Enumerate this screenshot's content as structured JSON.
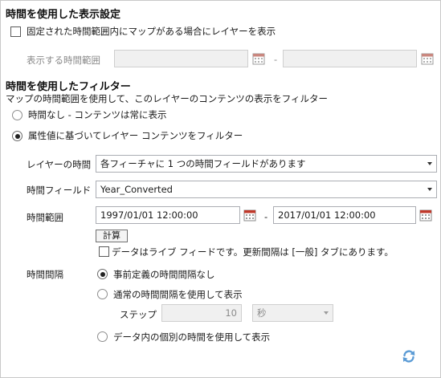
{
  "display_settings": {
    "title": "時間を使用した表示設定",
    "checkbox_label": "固定された時間範囲内にマップがある場合にレイヤーを表示",
    "range_label": "表示する時間範囲",
    "separator": "-",
    "start_value": "",
    "end_value": ""
  },
  "filter": {
    "title": "時間を使用したフィルター",
    "subtitle": "マップの時間範囲を使用して、このレイヤーのコンテンツの表示をフィルター",
    "radio_no_time": "時間なし - コンテンツは常に表示",
    "radio_attribute": "属性値に基づいてレイヤー コンテンツをフィルター",
    "layer_time": {
      "label": "レイヤーの時間",
      "value": "各フィーチャに 1 つの時間フィールドがあります"
    },
    "time_field": {
      "label": "時間フィールド",
      "value": "Year_Converted"
    },
    "time_extent": {
      "label": "時間範囲",
      "start": "1997/01/01 12:00:00",
      "separator": "-",
      "end": "2017/01/01 12:00:00",
      "calculate_label": "計算",
      "live_feed_label": "データはライブ フィードです。更新間隔は [一般] タブにあります。"
    },
    "time_interval": {
      "label": "時間間隔",
      "radio_none": "事前定義の時間間隔なし",
      "radio_regular": "通常の時間間隔を使用して表示",
      "step_label": "ステップ",
      "step_value": "10",
      "step_unit": "秒",
      "radio_individual": "データ内の個別の時間を使用して表示"
    }
  },
  "icons": {
    "calendar": "calendar-icon",
    "refresh": "refresh-icon"
  },
  "colors": {
    "accent_blue": "#3a7fc1",
    "calendar_red": "#c0392b",
    "disabled_gray": "#8a8a8a"
  }
}
